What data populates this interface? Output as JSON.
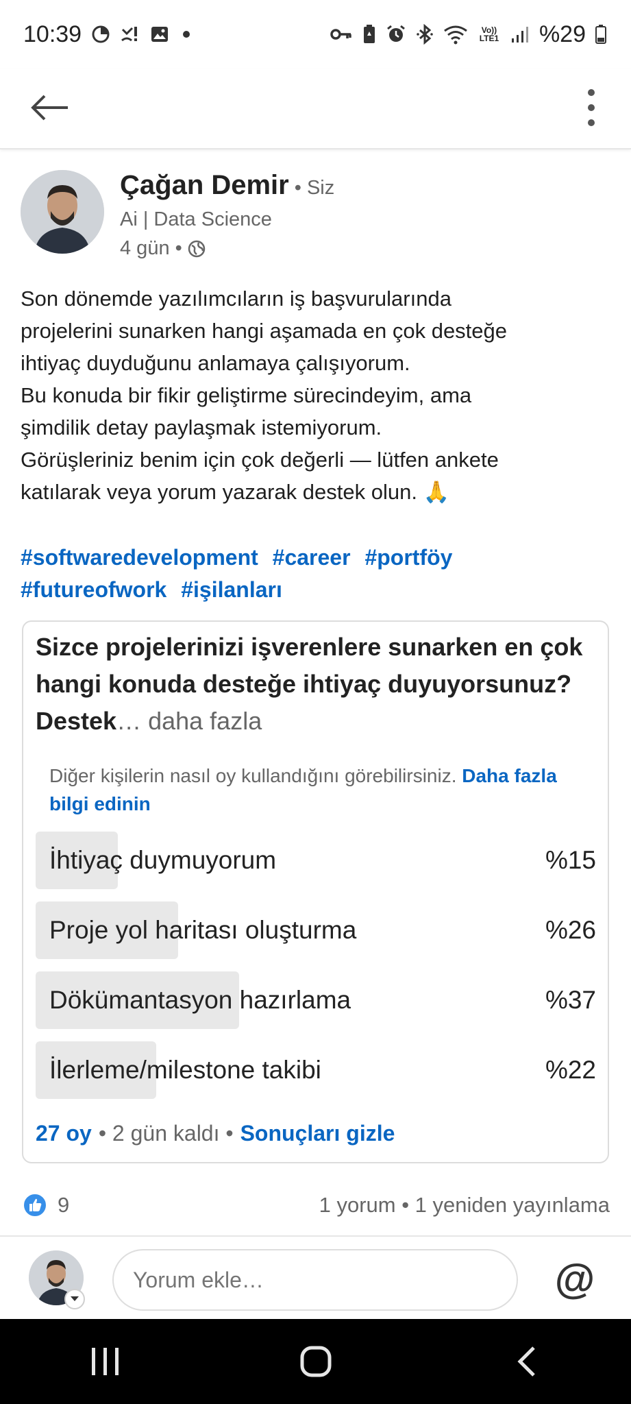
{
  "status_bar": {
    "time": "10:39",
    "battery": "%29",
    "icons_left": [
      "data-saver-icon",
      "missed-call-icon",
      "gallery-icon",
      "dot-icon"
    ],
    "icons_right": [
      "key-icon",
      "battery-saver-icon",
      "alarm-icon",
      "bluetooth-icon",
      "wifi-icon",
      "volte-icon",
      "signal-icon",
      "battery-icon"
    ],
    "volte_label": "Vo)) LTE1"
  },
  "app_bar": {
    "back_icon": "arrow-left-icon",
    "more_icon": "more-vertical-icon"
  },
  "author": {
    "name": "Çağan Demir",
    "you_label": "• Siz",
    "headline": "Ai | Data Science",
    "time": "4 gün •",
    "visibility_icon": "globe-icon"
  },
  "post": {
    "lines": [
      "Son dönemde yazılımcıların iş başvurularında",
      "projelerini sunarken hangi aşamada en çok desteğe",
      "ihtiyaç duyduğunu anlamaya çalışıyorum.",
      "Bu konuda bir fikir geliştirme sürecindeyim, ama",
      "şimdilik detay paylaşmak istemiyorum.",
      "Görüşleriniz benim için çok değerli — lütfen ankete",
      "katılarak veya yorum yazarak destek olun. 🙏"
    ],
    "hashtags": [
      "#softwaredevelopment",
      "#career",
      "#portföy",
      "#futureofwork",
      "#işilanları"
    ]
  },
  "poll": {
    "question": " Sizce projelerinizi işverenlere sunarken en çok hangi konuda desteğe ihtiyaç duyuyorsunuz?  Destek",
    "more": "… daha fazla",
    "notice": "Diğer kişilerin nasıl oy kullandığını görebilirsiniz.",
    "notice_link": "Daha fazla bilgi edinin",
    "options": [
      {
        "label": "İhtiyaç duymuyorum",
        "percent": "%15",
        "value": 15
      },
      {
        "label": "Proje yol haritası oluşturma",
        "percent": "%26",
        "value": 26
      },
      {
        "label": "Dökümantasyon hazırlama",
        "percent": "%37",
        "value": 37
      },
      {
        "label": "İlerleme/milestone takibi",
        "percent": "%22",
        "value": 22
      }
    ],
    "votes": "27 oy",
    "time_left": "• 2 gün kaldı •",
    "hide_results": "Sonuçları gizle"
  },
  "reactions": {
    "like_icon": "like-icon",
    "count": "9",
    "summary": "1 yorum • 1 yeniden yayınlama"
  },
  "comment_bar": {
    "placeholder": "Yorum ekle…",
    "mention": "@"
  },
  "nav": {
    "recent_icon": "recent-apps-icon",
    "home_icon": "home-icon",
    "back_icon": "back-nav-icon"
  },
  "colors": {
    "accent": "#0a66c2",
    "poll_fill": "#e8e8e8",
    "muted_text": "#666666"
  }
}
